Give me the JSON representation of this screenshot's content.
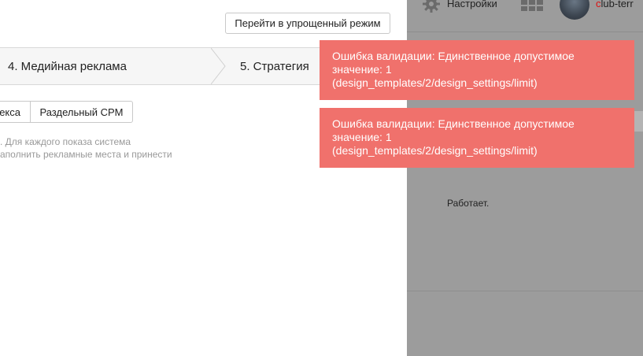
{
  "toolbar": {
    "simple_mode_label": "Перейти в упрощенный режим"
  },
  "steps": [
    {
      "label": "4. Медийная реклама"
    },
    {
      "label": "5. Стратегия"
    }
  ],
  "pricing_tabs": [
    {
      "label": "екса"
    },
    {
      "label": "Раздельный CPM"
    }
  ],
  "description": {
    "line1": ". Для каждого показа система",
    "line2": "аполнить рекламные места и принести"
  },
  "header": {
    "settings_label": "Настройки",
    "username_first": "c",
    "username_rest": "lub-terr",
    "icons": [
      "gear-icon",
      "apps-grid-icon",
      "avatar"
    ]
  },
  "status_text": "Работает.",
  "errors": [
    {
      "lines": [
        "Ошибка валидации: Единственное допустимое",
        "значение: 1",
        "(design_templates/2/design_settings/limit)"
      ]
    },
    {
      "lines": [
        "Ошибка валидации: Единственное допустимое",
        "значение: 1",
        "(design_templates/2/design_settings/limit)"
      ]
    }
  ],
  "colors": {
    "error_bg": "#f0716c",
    "overlay_bg": "#9c9c9c",
    "steps_bg": "#f6f6f6"
  }
}
